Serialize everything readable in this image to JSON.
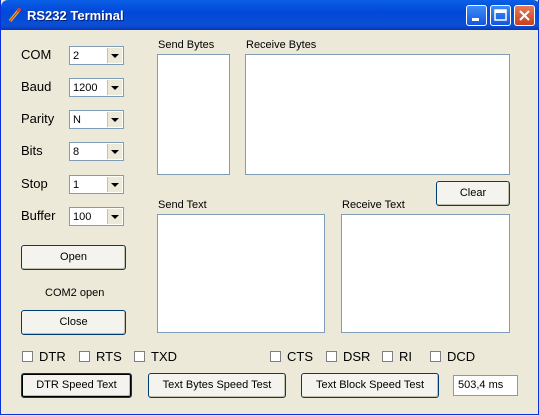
{
  "window": {
    "title": "RS232 Terminal"
  },
  "settings": [
    {
      "label": "COM",
      "value": "2"
    },
    {
      "label": "Baud",
      "value": "1200"
    },
    {
      "label": "Parity",
      "value": "N"
    },
    {
      "label": "Bits",
      "value": "8"
    },
    {
      "label": "Stop",
      "value": "1"
    },
    {
      "label": "Buffer",
      "value": "100"
    }
  ],
  "buttons": {
    "open": "Open",
    "close": "Close",
    "clear": "Clear",
    "dtr_speed": "DTR Speed Text",
    "text_bytes_speed": "Text Bytes Speed Test",
    "text_block_speed": "Text Block Speed Test"
  },
  "status": "COM2 open",
  "panels": {
    "send_bytes": "Send Bytes",
    "receive_bytes": "Receive Bytes",
    "send_text": "Send Text",
    "receive_text": "Receive Text"
  },
  "checkboxes": [
    "DTR",
    "RTS",
    "TXD",
    "CTS",
    "DSR",
    "RI",
    "DCD"
  ],
  "timing": "503,4 ms"
}
